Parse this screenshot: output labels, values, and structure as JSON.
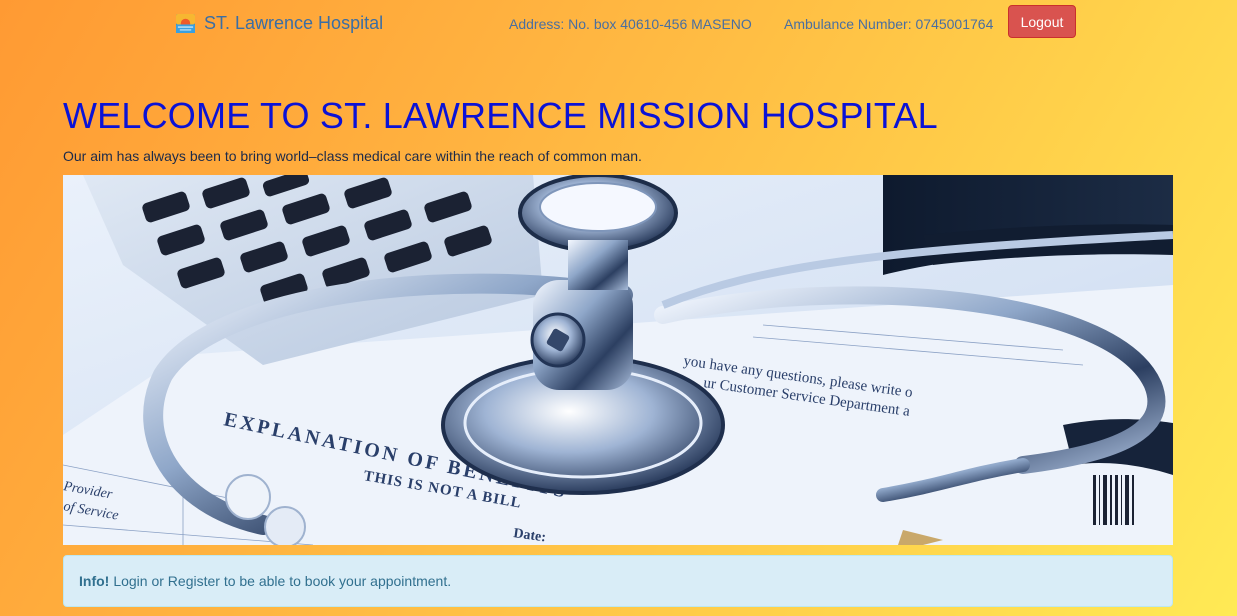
{
  "navbar": {
    "brand": "ST. Lawrence Hospital",
    "address": "Address: No. box 40610-456 MASENO",
    "ambulance": "Ambulance Number: 0745001764",
    "logout_label": "Logout"
  },
  "hero": {
    "title": "WELCOME TO ST. LAWRENCE MISSION HOSPITAL",
    "subtitle": "Our aim has always been to bring world–class medical care within the reach of common man.",
    "image": {
      "doc_line1": "you have any questions, please write o",
      "doc_line2": "ur Customer Service Department a",
      "doc_heading": "EXPLANATION OF BENEFITS",
      "doc_not_bill": "THIS IS NOT A BILL",
      "doc_date": "Date:",
      "doc_provider": "Provider",
      "doc_service": "of Service"
    }
  },
  "alert": {
    "strong": "Info!",
    "text": "Login or Register to be able to book your appointment."
  },
  "colors": {
    "title": "#0b12d6",
    "logout": "#d9534f",
    "alert_bg": "#d9edf7",
    "alert_text": "#31708f"
  }
}
